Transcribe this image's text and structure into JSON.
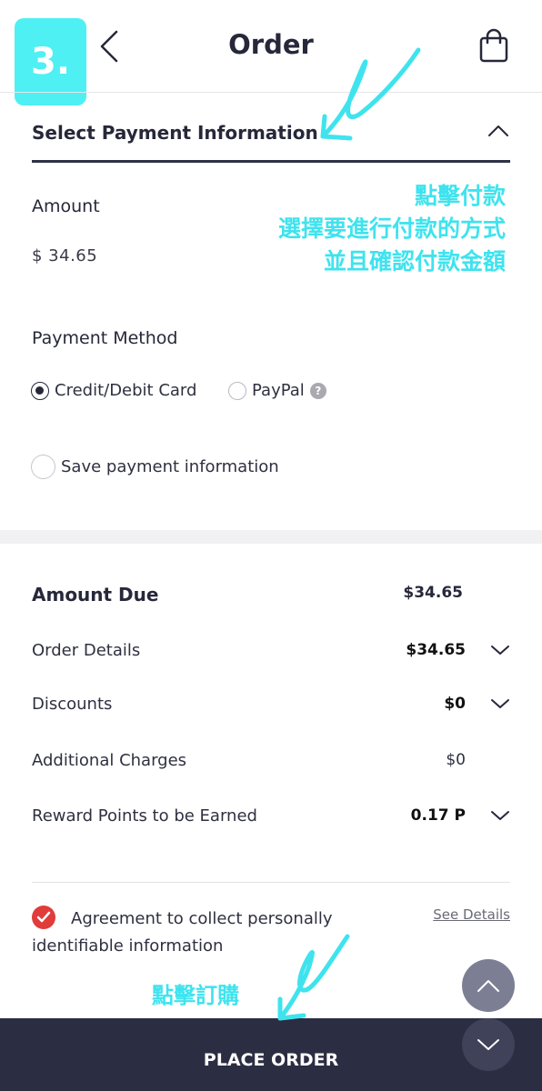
{
  "step_badge": "3.",
  "header": {
    "title": "Order",
    "back_icon": "chevron-left-icon",
    "cart_icon": "shopping-bag-icon"
  },
  "payment_section": {
    "title": "Select Payment Information",
    "amount_label": "Amount",
    "amount_value": "$ 34.65",
    "method_label": "Payment Method",
    "methods": [
      {
        "label": "Credit/Debit Card",
        "selected": true
      },
      {
        "label": "PayPal",
        "selected": false
      }
    ],
    "help_glyph": "?",
    "save_label": "Save payment information"
  },
  "summary": {
    "amount_due_label": "Amount Due",
    "amount_due_value": "$34.65",
    "rows": [
      {
        "label": "Order Details",
        "value": "$34.65",
        "expandable": true
      },
      {
        "label": "Discounts",
        "value": "$0",
        "expandable": true
      },
      {
        "label": "Additional Charges",
        "value": "$0",
        "expandable": false
      },
      {
        "label": "Reward Points to be Earned",
        "value": "0.17 P",
        "expandable": true
      }
    ]
  },
  "agreement": {
    "text": "Agreement to collect personally identifiable information",
    "checked": true,
    "link": "See Details"
  },
  "footer": {
    "button": "PLACE ORDER"
  },
  "annotations": {
    "line1": "點擊付款",
    "line2": "選擇要進行付款的方式",
    "line3": "並且確認付款金額",
    "order_note": "點擊訂購"
  },
  "colors": {
    "accent_cyan": "#4ef0f3",
    "primary_dark": "#2b2d42",
    "check_red": "#e03c3c"
  }
}
